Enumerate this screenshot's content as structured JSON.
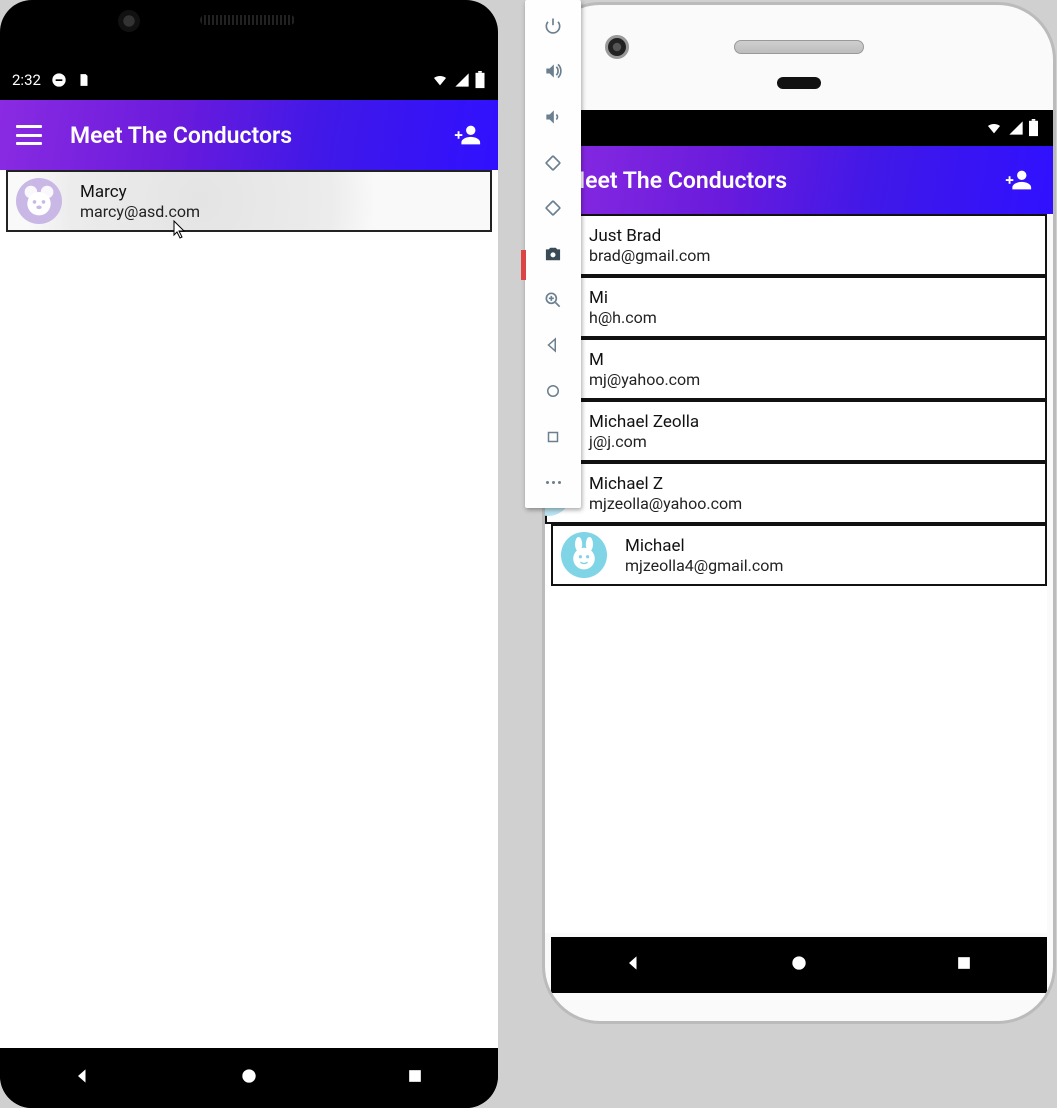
{
  "left_phone": {
    "status": {
      "time": "2:32"
    },
    "appbar": {
      "title": "Meet The Conductors"
    },
    "contacts": [
      {
        "name": "Marcy",
        "email": "marcy@asd.com",
        "avatar": "bear-purple"
      }
    ]
  },
  "right_phone": {
    "appbar": {
      "title": "Meet The Conductors"
    },
    "contacts": [
      {
        "name": "Just Brad",
        "email": "brad@gmail.com",
        "avatar": "purple-d"
      },
      {
        "name": "Mi",
        "email": "h@h.com",
        "avatar": "purple-l"
      },
      {
        "name": "M",
        "email": "mj@yahoo.com",
        "avatar": "lav"
      },
      {
        "name": "Michael Zeolla",
        "email": "j@j.com",
        "avatar": "blue-l"
      },
      {
        "name": "Michael Z",
        "email": "mjzeolla@yahoo.com",
        "avatar": "cyan-l"
      },
      {
        "name": "Michael",
        "email": "mjzeolla4@gmail.com",
        "avatar": "cyan"
      }
    ]
  },
  "emu_toolbar": {
    "buttons": [
      "power",
      "volume-up",
      "volume-down",
      "rotate-left",
      "rotate-right",
      "camera",
      "zoom-in",
      "back",
      "home",
      "overview",
      "more"
    ],
    "active": "camera"
  }
}
